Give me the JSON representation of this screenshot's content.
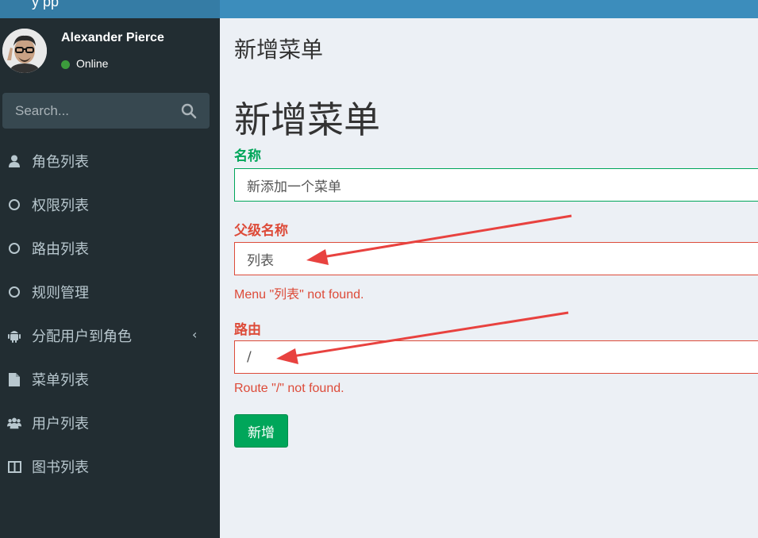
{
  "app": {
    "logo_text": "y  pp"
  },
  "user": {
    "name": "Alexander Pierce",
    "status": "Online",
    "status_color": "#3c9c3c"
  },
  "search": {
    "placeholder": "Search..."
  },
  "sidebar": {
    "items": [
      {
        "label": "角色列表",
        "icon": "user-icon"
      },
      {
        "label": "权限列表",
        "icon": "circle-icon"
      },
      {
        "label": "路由列表",
        "icon": "circle-icon"
      },
      {
        "label": "规则管理",
        "icon": "circle-icon"
      },
      {
        "label": "分配用户到角色",
        "icon": "android-icon",
        "chevron": "‹"
      },
      {
        "label": "菜单列表",
        "icon": "file-icon"
      },
      {
        "label": "用户列表",
        "icon": "users-icon"
      },
      {
        "label": "图书列表",
        "icon": "columns-icon"
      }
    ]
  },
  "page": {
    "header": "新增菜单"
  },
  "form": {
    "title": "新增菜单",
    "name": {
      "label": "名称",
      "value": "新添加一个菜单"
    },
    "parent": {
      "label": "父级名称",
      "value": "列表",
      "error": "Menu \"列表\" not found."
    },
    "route": {
      "label": "路由",
      "value": "/",
      "error": "Route \"/\" not found."
    },
    "submit_label": "新增"
  },
  "colors": {
    "success": "#00a65a",
    "danger": "#dd4b39",
    "sidebar": "#222d32",
    "header": "#3c8dbc",
    "annotation": "#e8423f"
  }
}
